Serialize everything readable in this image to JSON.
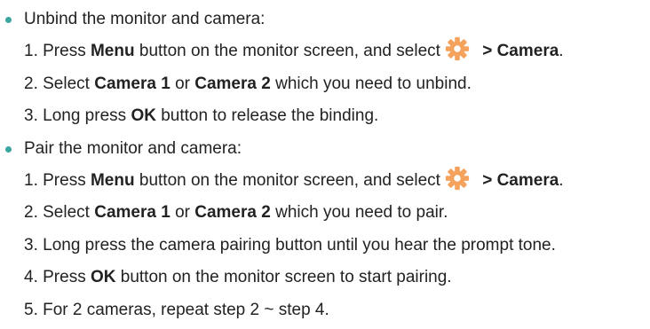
{
  "sections": [
    {
      "heading": "Unbind the monitor and camera:",
      "steps": {
        "s1": {
          "num": "1.",
          "a": " Press ",
          "b1": "Menu",
          "c": " button on the monitor screen, and select",
          "d": " > ",
          "b2": "Camera",
          "e": "."
        },
        "s2": {
          "num": "2.",
          "a": " Select ",
          "b1": "Camera 1",
          "c": " or ",
          "b2": "Camera 2",
          "e": " which you need to unbind."
        },
        "s3": {
          "num": "3.",
          "a": " Long press ",
          "b1": "OK",
          "e": " button to release the binding."
        }
      }
    },
    {
      "heading": "Pair the monitor and camera:",
      "steps": {
        "s1": {
          "num": "1.",
          "a": " Press ",
          "b1": "Menu",
          "c": " button on the monitor screen, and select",
          "d": " > ",
          "b2": "Camera",
          "e": "."
        },
        "s2": {
          "num": "2.",
          "a": " Select ",
          "b1": "Camera 1",
          "c": " or ",
          "b2": "Camera 2",
          "e": " which you need to pair."
        },
        "s3": {
          "num": "3.",
          "e": " Long press the camera pairing button until you hear the prompt tone."
        },
        "s4": {
          "num": "4.",
          "a": " Press ",
          "b1": "OK",
          "e": " button on the monitor screen to start pairing."
        },
        "s5": {
          "num": "5.",
          "e": " For 2 cameras, repeat step 2 ~ step 4."
        }
      }
    }
  ],
  "icons": {
    "bullet_color": "#3aa6a0",
    "gear_color": "#f5a25d",
    "gear_icon": "settings-gear-icon"
  }
}
